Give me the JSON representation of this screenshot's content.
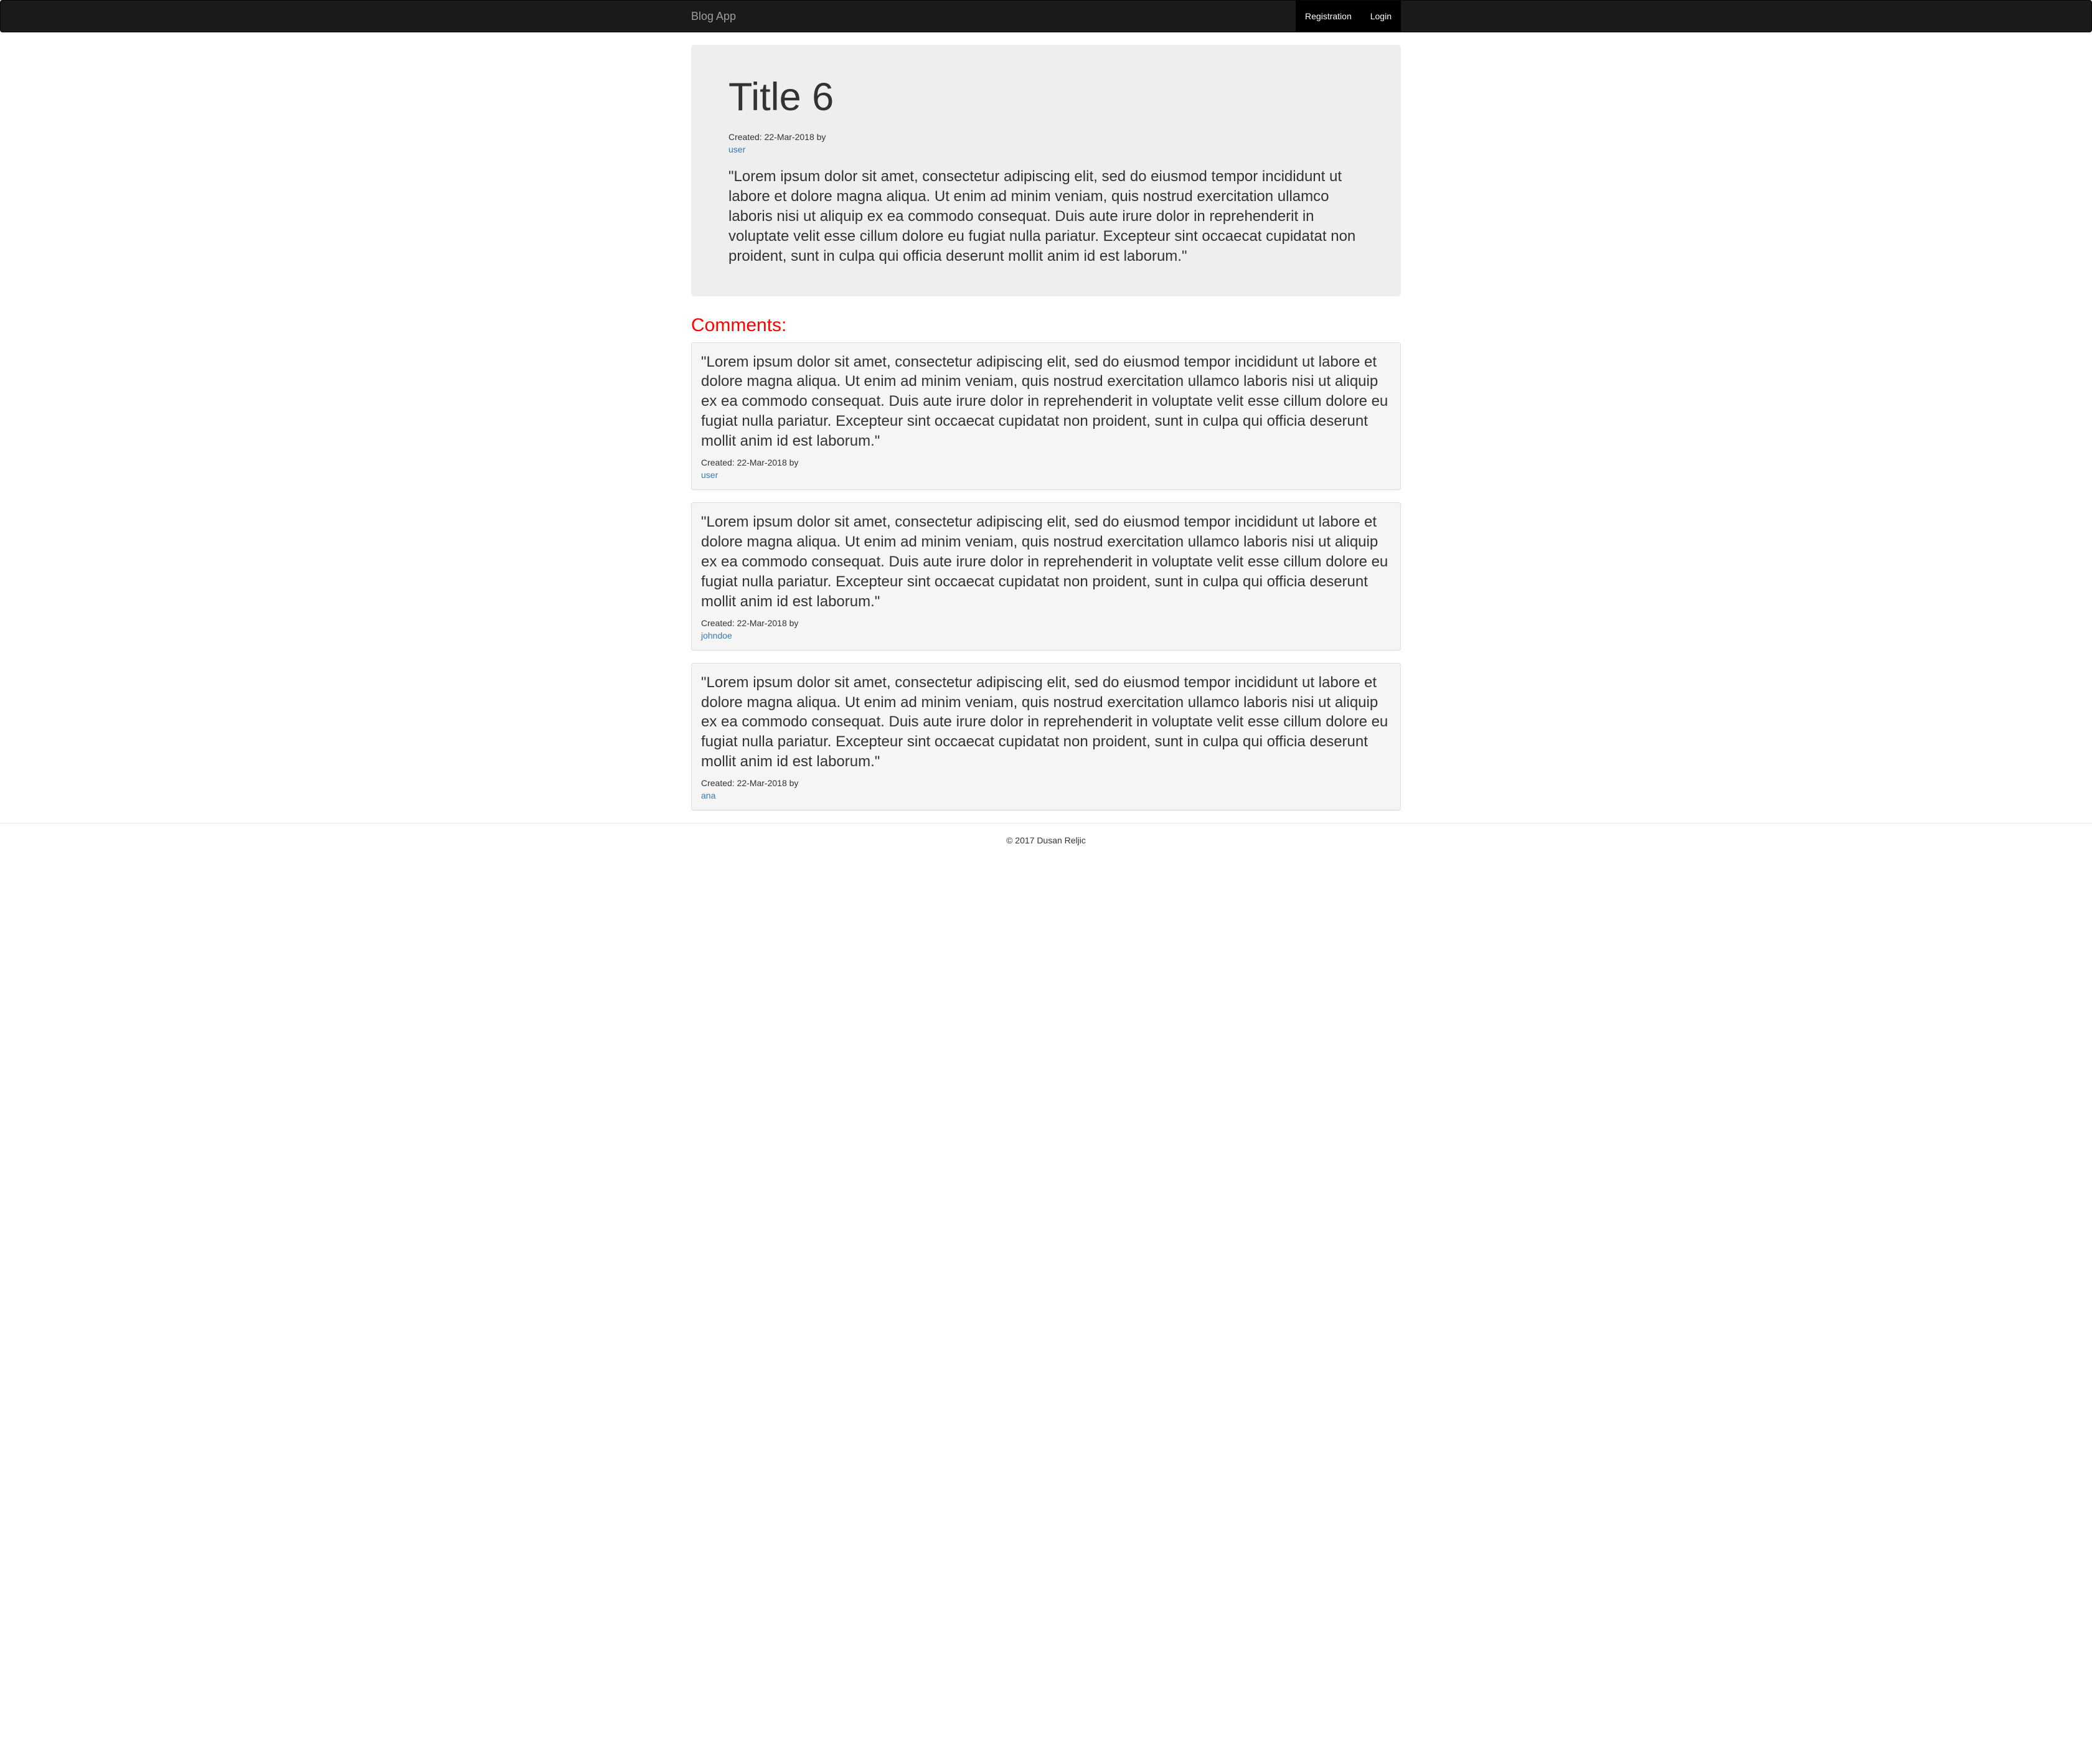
{
  "nav": {
    "brand": "Blog App",
    "registration": "Registration",
    "login": "Login"
  },
  "post": {
    "title": "Title 6",
    "meta": "Created: 22-Mar-2018 by",
    "author": "user",
    "body": "\"Lorem ipsum dolor sit amet, consectetur adipiscing elit, sed do eiusmod tempor incididunt ut labore et dolore magna aliqua. Ut enim ad minim veniam, quis nostrud exercitation ullamco laboris nisi ut aliquip ex ea commodo consequat. Duis aute irure dolor in reprehenderit in voluptate velit esse cillum dolore eu fugiat nulla pariatur. Excepteur sint occaecat cupidatat non proident, sunt in culpa qui officia deserunt mollit anim id est laborum.\""
  },
  "comments_heading": "Comments:",
  "comments": [
    {
      "body": "\"Lorem ipsum dolor sit amet, consectetur adipiscing elit, sed do eiusmod tempor incididunt ut labore et dolore magna aliqua. Ut enim ad minim veniam, quis nostrud exercitation ullamco laboris nisi ut aliquip ex ea commodo consequat. Duis aute irure dolor in reprehenderit in voluptate velit esse cillum dolore eu fugiat nulla pariatur. Excepteur sint occaecat cupidatat non proident, sunt in culpa qui officia deserunt mollit anim id est laborum.\"",
      "meta": "Created: 22-Mar-2018 by",
      "author": "user"
    },
    {
      "body": "\"Lorem ipsum dolor sit amet, consectetur adipiscing elit, sed do eiusmod tempor incididunt ut labore et dolore magna aliqua. Ut enim ad minim veniam, quis nostrud exercitation ullamco laboris nisi ut aliquip ex ea commodo consequat. Duis aute irure dolor in reprehenderit in voluptate velit esse cillum dolore eu fugiat nulla pariatur. Excepteur sint occaecat cupidatat non proident, sunt in culpa qui officia deserunt mollit anim id est laborum.\"",
      "meta": "Created: 22-Mar-2018 by",
      "author": "johndoe"
    },
    {
      "body": "\"Lorem ipsum dolor sit amet, consectetur adipiscing elit, sed do eiusmod tempor incididunt ut labore et dolore magna aliqua. Ut enim ad minim veniam, quis nostrud exercitation ullamco laboris nisi ut aliquip ex ea commodo consequat. Duis aute irure dolor in reprehenderit in voluptate velit esse cillum dolore eu fugiat nulla pariatur. Excepteur sint occaecat cupidatat non proident, sunt in culpa qui officia deserunt mollit anim id est laborum.\"",
      "meta": "Created: 22-Mar-2018 by",
      "author": "ana"
    }
  ],
  "footer": "© 2017 Dusan Reljic"
}
